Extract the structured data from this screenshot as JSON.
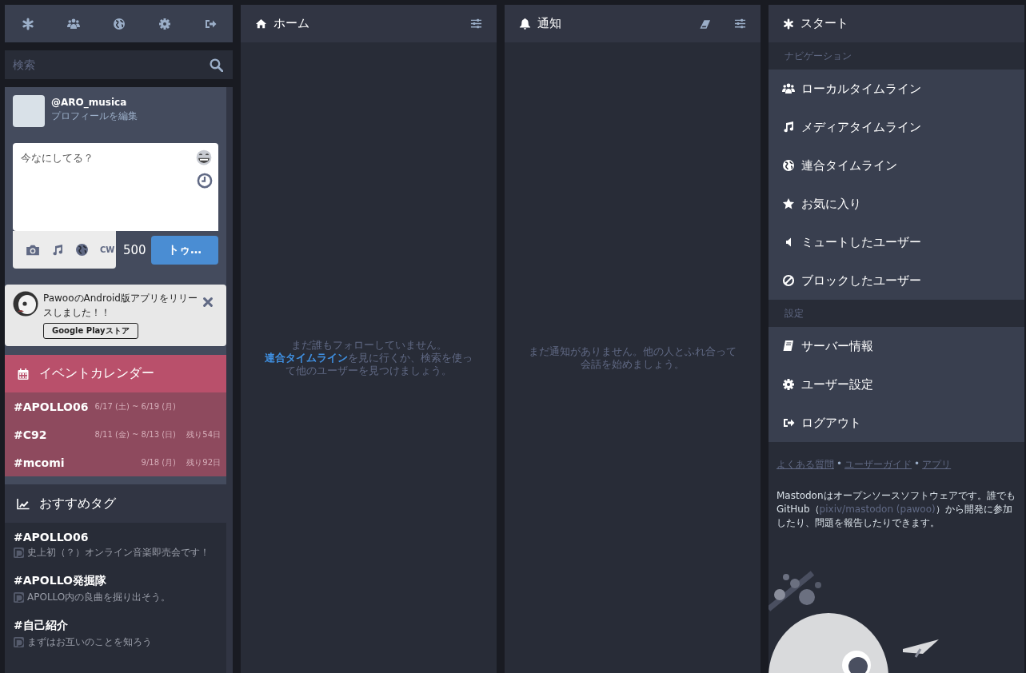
{
  "search": {
    "placeholder": "検索"
  },
  "account": {
    "handle": "@ARO_musica",
    "edit_link": "プロフィールを編集"
  },
  "compose": {
    "placeholder": "今なにしてる？",
    "cw_label": "CW",
    "counter": "500",
    "submit": "トゥ…"
  },
  "announcement": {
    "text": "PawooのAndroid版アプリをリリースしました！！",
    "button": "Google Playストア"
  },
  "event_calendar": {
    "title": "イベントカレンダー",
    "events": [
      {
        "tag": "#APOLLO06",
        "dates": "6/17 (土) ~ 6/19 (月)"
      },
      {
        "tag": "#C92",
        "dates": "8/11 (金) ~ 8/13 (日)",
        "remaining": "残り54日"
      },
      {
        "tag": "#mcomi",
        "dates": "9/18 (月)",
        "remaining": "残り92日"
      }
    ]
  },
  "suggested_tags": {
    "title": "おすすめタグ",
    "tags": [
      {
        "tag": "#APOLLO06",
        "description": "史上初（？）オンライン音楽即売会です！"
      },
      {
        "tag": "#APOLLO発掘隊",
        "description": "APOLLO内の良曲を掘り出そう。"
      },
      {
        "tag": "#自己紹介",
        "description": "まずはお互いのことを知ろう"
      }
    ]
  },
  "columns": [
    {
      "title": "ホーム",
      "empty_before": "まだ誰もフォローしていません。",
      "empty_link": "連合タイムライン",
      "empty_after": "を見に行くか、検索を使って他のユーザーを見つけましょう。"
    },
    {
      "title": "通知",
      "empty_before": "まだ通知がありません。他の人とふれ合って会話を始めましょう。"
    }
  ],
  "start": {
    "title": "スタート",
    "sections": [
      {
        "label": "ナビゲーション",
        "items": [
          "ローカルタイムライン",
          "メディアタイムライン",
          "連合タイムライン",
          "お気に入り",
          "ミュートしたユーザー",
          "ブロックしたユーザー"
        ]
      },
      {
        "label": "設定",
        "items": [
          "サーバー情報",
          "ユーザー設定",
          "ログアウト"
        ]
      }
    ]
  },
  "footer": {
    "links": [
      "よくある質問",
      "ユーザーガイド",
      "アプリ"
    ],
    "separators": [
      "•",
      "•"
    ],
    "about_before": "Mastodonはオープンソースソフトウェアです。誰でもGitHub（",
    "about_link": "pixiv/mastodon (pawoo)",
    "about_after": "）から開発に参加したり、問題を報告したりできます。"
  }
}
